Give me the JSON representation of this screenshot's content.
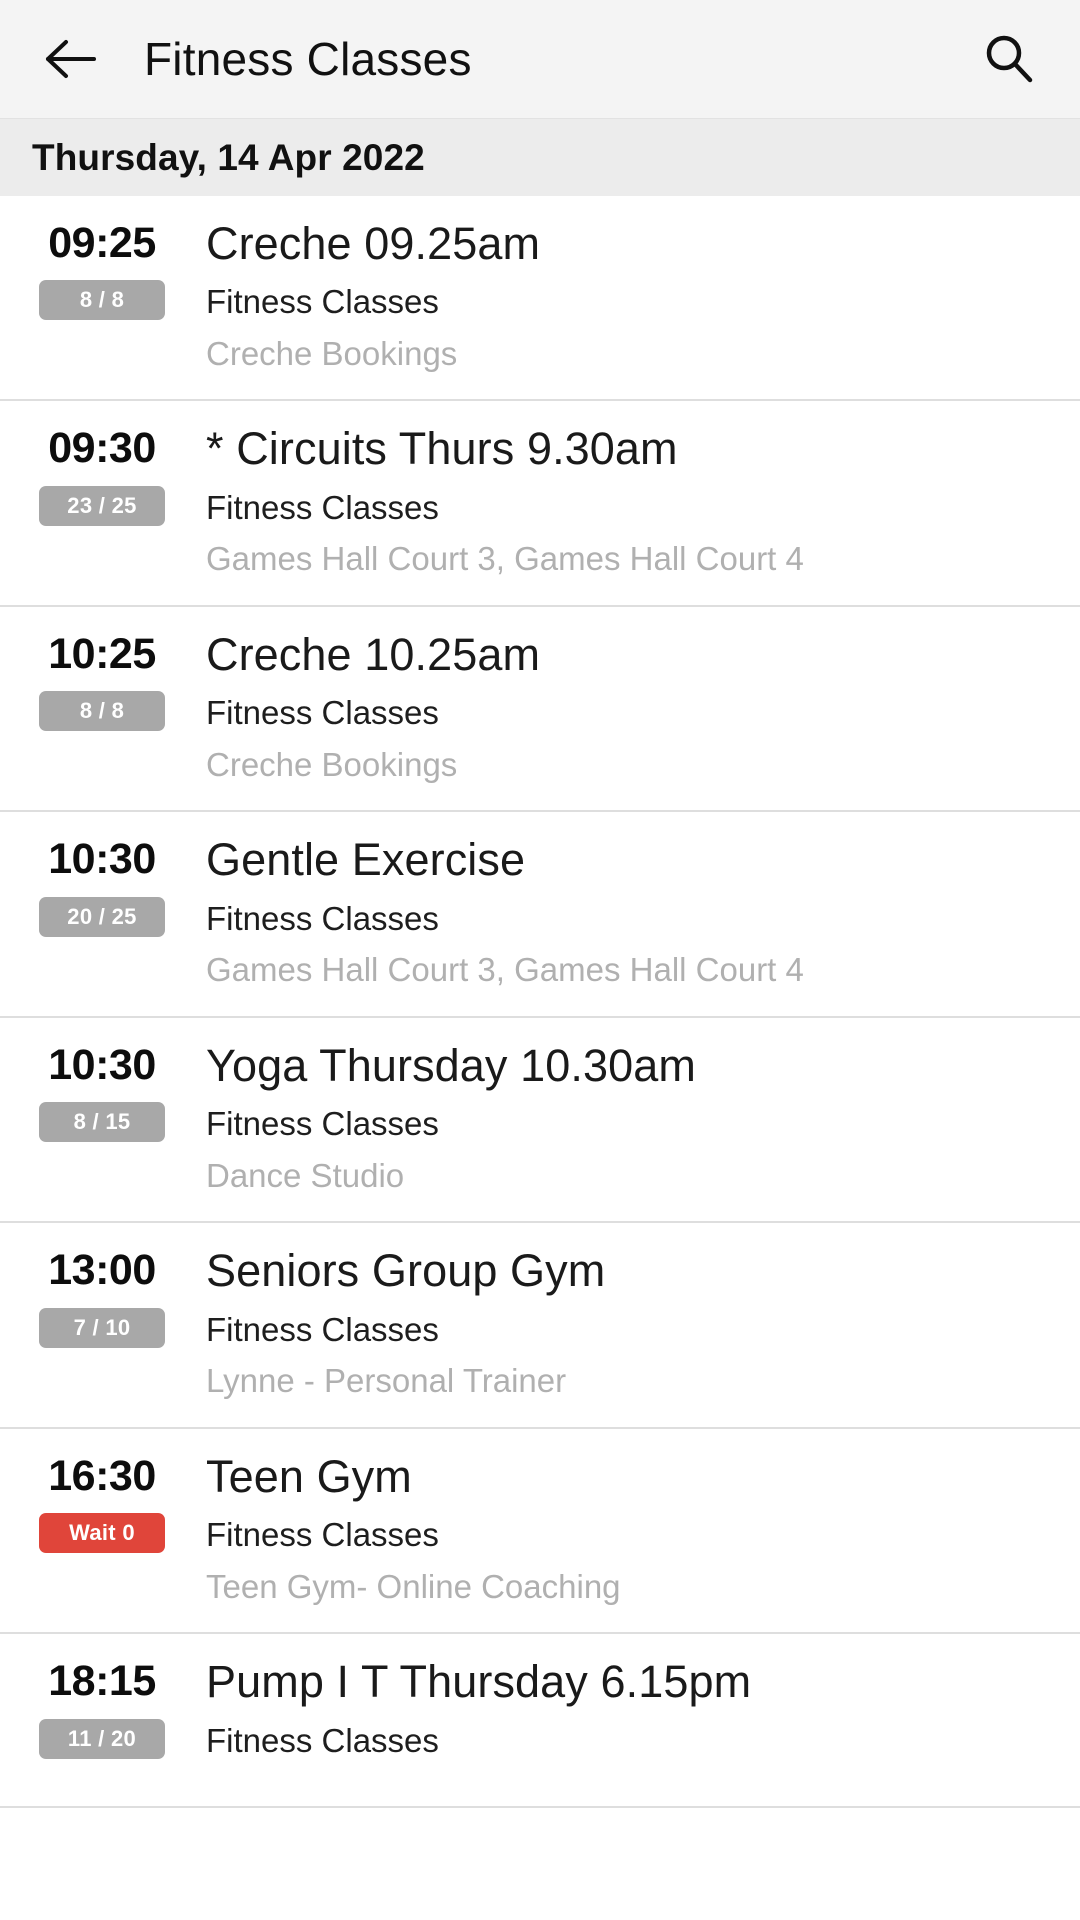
{
  "appbar": {
    "back_icon": "arrow-left-icon",
    "title": "Fitness Classes",
    "search_icon": "search-icon"
  },
  "date_header": {
    "label": "Thursday, 14 Apr 2022"
  },
  "colors": {
    "appbar_bg": "#f4f4f4",
    "date_bg": "#ececec",
    "badge_grey": "#a8a8a8",
    "badge_red": "#e0453a",
    "location_text": "#b0b0b0",
    "divider": "#dedede"
  },
  "classes": [
    {
      "time": "09:25",
      "badge": "8 / 8",
      "badge_type": "capacity",
      "title": "Creche 09.25am",
      "category": "Fitness Classes",
      "location": "Creche Bookings"
    },
    {
      "time": "09:30",
      "badge": "23 / 25",
      "badge_type": "capacity",
      "title": "* Circuits Thurs 9.30am",
      "category": "Fitness Classes",
      "location": "Games Hall Court 3, Games Hall Court 4"
    },
    {
      "time": "10:25",
      "badge": "8 / 8",
      "badge_type": "capacity",
      "title": "Creche 10.25am",
      "category": "Fitness Classes",
      "location": "Creche Bookings"
    },
    {
      "time": "10:30",
      "badge": "20 / 25",
      "badge_type": "capacity",
      "title": "Gentle Exercise",
      "category": "Fitness Classes",
      "location": "Games Hall Court 3, Games Hall Court 4"
    },
    {
      "time": "10:30",
      "badge": "8 / 15",
      "badge_type": "capacity",
      "title": "Yoga Thursday 10.30am",
      "category": "Fitness Classes",
      "location": "Dance Studio"
    },
    {
      "time": "13:00",
      "badge": "7 / 10",
      "badge_type": "capacity",
      "title": "Seniors Group Gym",
      "category": "Fitness Classes",
      "location": "Lynne - Personal Trainer"
    },
    {
      "time": "16:30",
      "badge": "Wait 0",
      "badge_type": "wait",
      "title": "Teen Gym",
      "category": "Fitness Classes",
      "location": "Teen Gym- Online Coaching"
    },
    {
      "time": "18:15",
      "badge": "11 / 20",
      "badge_type": "capacity",
      "title": "Pump I T Thursday 6.15pm",
      "category": "Fitness Classes",
      "location": ""
    }
  ]
}
